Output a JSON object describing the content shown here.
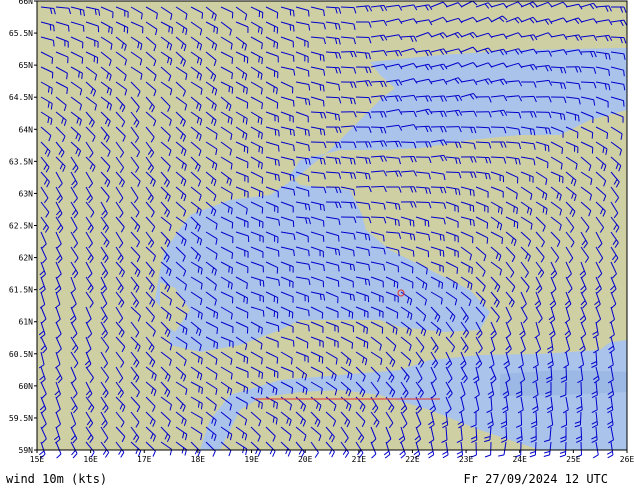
{
  "map": {
    "lat_range": [
      59,
      66
    ],
    "lon_range": [
      15,
      26
    ],
    "lat_ticks": [
      "59N",
      "59.5N",
      "60N",
      "60.5N",
      "61N",
      "61.5N",
      "62N",
      "62.5N",
      "63N",
      "63.5N",
      "64N",
      "64.5N",
      "65N",
      "65.5N",
      "66N"
    ],
    "lon_ticks": [
      "15E",
      "16E",
      "17E",
      "18E",
      "19E",
      "20E",
      "21E",
      "22E",
      "23E",
      "24E",
      "25E",
      "26E"
    ],
    "colors": {
      "land": "#cfcfa4",
      "sea": "#a9c3ea",
      "sea_dark": "#9cb8e4",
      "barb": "#0000cc",
      "frame": "#000000",
      "marker": "#e03030"
    },
    "wind_field": "wind barbs drawn in blue on a regular grid"
  },
  "footer": {
    "left": "wind 10m (kts)",
    "right": "Fr 27/09/2024 12 UTC"
  }
}
